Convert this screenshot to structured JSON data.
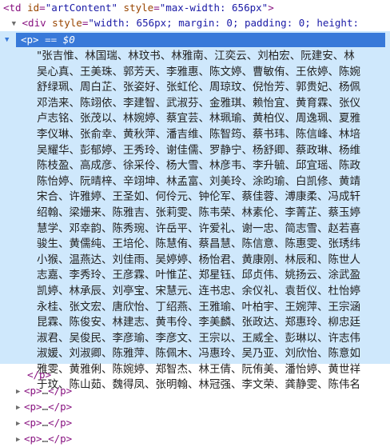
{
  "td_line": {
    "open": "<td",
    "id_name": "id",
    "id_value": "\"artContent\"",
    "style_name": "style",
    "style_value": "\"max-width: 656px\"",
    "close": ">"
  },
  "div_line": {
    "open": "<div",
    "style_name": "style",
    "style_value": "\"width: 656px; margin: 0; padding: 0; height:"
  },
  "p_line": {
    "open": "<p>",
    "eq": "==",
    "dollar": "$0"
  },
  "names_rows": [
    "\"张吉惟、林国瑞、林玟书、林雅南、江奕云、刘柏宏、阮建安、林",
    "吴心真、王美珠、郭芳天、李雅惠、陈文婷、曹敏侑、王依婷、陈婉",
    "舒绿珮、周白芷、张姿好、张虹伦、周琼玟、倪怡芳、郭贵妃、杨佩",
    "邓浩来、陈翊依、李建智、武淑芬、金雅琪、赖怡宜、黄育霖、张仪",
    "卢志铭、张茂以、林婉婷、蔡宜芸、林珮瑜、黄柏仪、周逸珮、夏雅",
    "李仪琳、张俞幸、黄秋萍、潘吉维、陈智筠、蔡书玮、陈信峰、林培",
    "吴耀华、彭郁婷、王秀玲、谢佳儒、罗静宁、杨舒卿、蔡政琳、杨维",
    "陈枝盈、高成彦、徐采伶、杨大雪、林彦韦、李升毓、邱宜瑶、陈政",
    "陈怡婷、阮晴梓、辛翊坤、林孟富、刘美玲、涂昀瑜、白凯修、黄靖",
    "宋合、许雅婷、王圣如、何伶元、钟伦军、蔡佳蓉、溥康柔、冯成轩",
    "绍翰、梁姗来、陈雅吉、张莉雯、陈韦荣、林素伦、李菁芷、蔡玉婷",
    "慧学、邓幸韵、陈秀琬、许岳平、许爱礼、谢一忠、简志雪、赵若喜",
    "骏生、黄儒纯、王培伦、陈慧侑、蔡昌慧、陈信意、陈惠雯、张琇纬",
    "小猴、温燕达、刘佳雨、吴婷婷、杨怡君、黄康刚、林辰和、陈世人",
    "志嘉、李秀玲、王彦霖、叶惟芷、郑星钰、邱贞伟、姚扬云、涂武盈",
    "凯婷、林承辰、刘亭宝、宋慧元、连书忠、余仪礼、袁哲仪、杜怡婷",
    "永桂、张文宏、唐欣怡、丁绍燕、王雅瑜、叶柏宇、王婉萍、王宗涵",
    "昆霖、陈俊安、林建志、黄韦伶、李美麟、张政达、郑惠玲、柳忠廷",
    "淑君、吴俊民、李彦瑜、李彦文、王宗以、王威全、彭琳以、许志伟",
    "淑媛、刘淑卿、陈雅萍、陈佩木、冯惠玲、吴乃亚、刘欣怡、陈意如",
    "雅雯、黄雅俐、陈婉婷、郑智杰、林王倩、阮侑美、潘怡婷、黄世祥",
    "于玟、陈山茹、魏得凤、张明翰、林冠强、李文荣、龚静雯、陈伟名"
  ],
  "p_close": "</p>",
  "collapsed": {
    "open": "<p>",
    "ellipsis": "…",
    "close": "</p>",
    "count": 5
  }
}
